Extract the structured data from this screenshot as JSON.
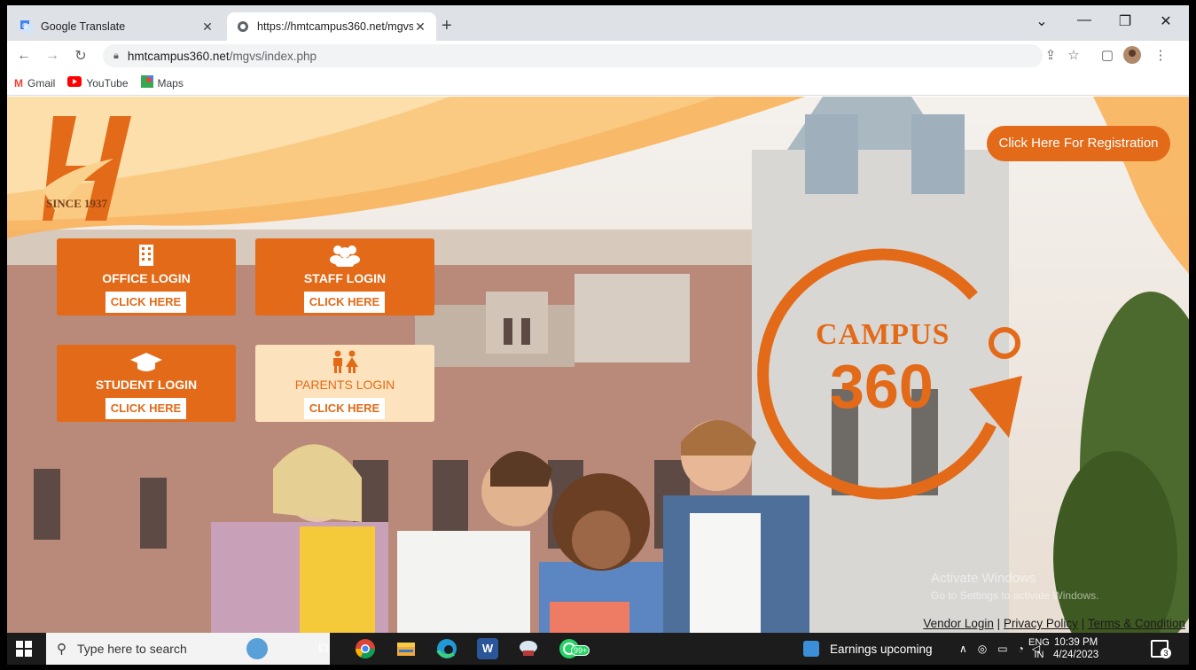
{
  "browser": {
    "tabs": [
      {
        "title": "Google Translate",
        "active": false
      },
      {
        "title": "https://hmtcampus360.net/mgvs",
        "active": true
      }
    ],
    "address": {
      "domain": "hmtcampus360.net",
      "path": "/mgvs/index.php"
    },
    "bookmarks": [
      "Gmail",
      "YouTube",
      "Maps"
    ]
  },
  "page": {
    "logo_text": "SINCE 1937",
    "registration_button": "Click Here For Registration",
    "logins": [
      {
        "title": "OFFICE LOGIN",
        "link": "CLICK HERE",
        "icon": "building-icon"
      },
      {
        "title": "STAFF LOGIN",
        "link": "CLICK HERE",
        "icon": "users-icon"
      },
      {
        "title": "STUDENT LOGIN",
        "link": "CLICK HERE",
        "icon": "graduation-cap-icon"
      },
      {
        "title": "PARENTS LOGIN",
        "link": "CLICK HERE",
        "icon": "parents-icon"
      }
    ],
    "campus_logo": {
      "word": "CAMPUS",
      "number": "360"
    },
    "watermark": {
      "line1": "Activate Windows",
      "line2": "Go to Settings to activate Windows."
    },
    "footer_links": [
      "Vendor Login",
      "Privacy Policy",
      "Terms & Condition"
    ]
  },
  "taskbar": {
    "search_placeholder": "Type here to search",
    "weather": "Earnings upcoming",
    "lang_top": "ENG",
    "lang_bottom": "IN",
    "time": "10:39 PM",
    "date": "4/24/2023",
    "whatsapp_badge": "99+",
    "notification_count": "3"
  },
  "colors": {
    "accent": "#e36a18",
    "light_card": "#fde3bd"
  }
}
